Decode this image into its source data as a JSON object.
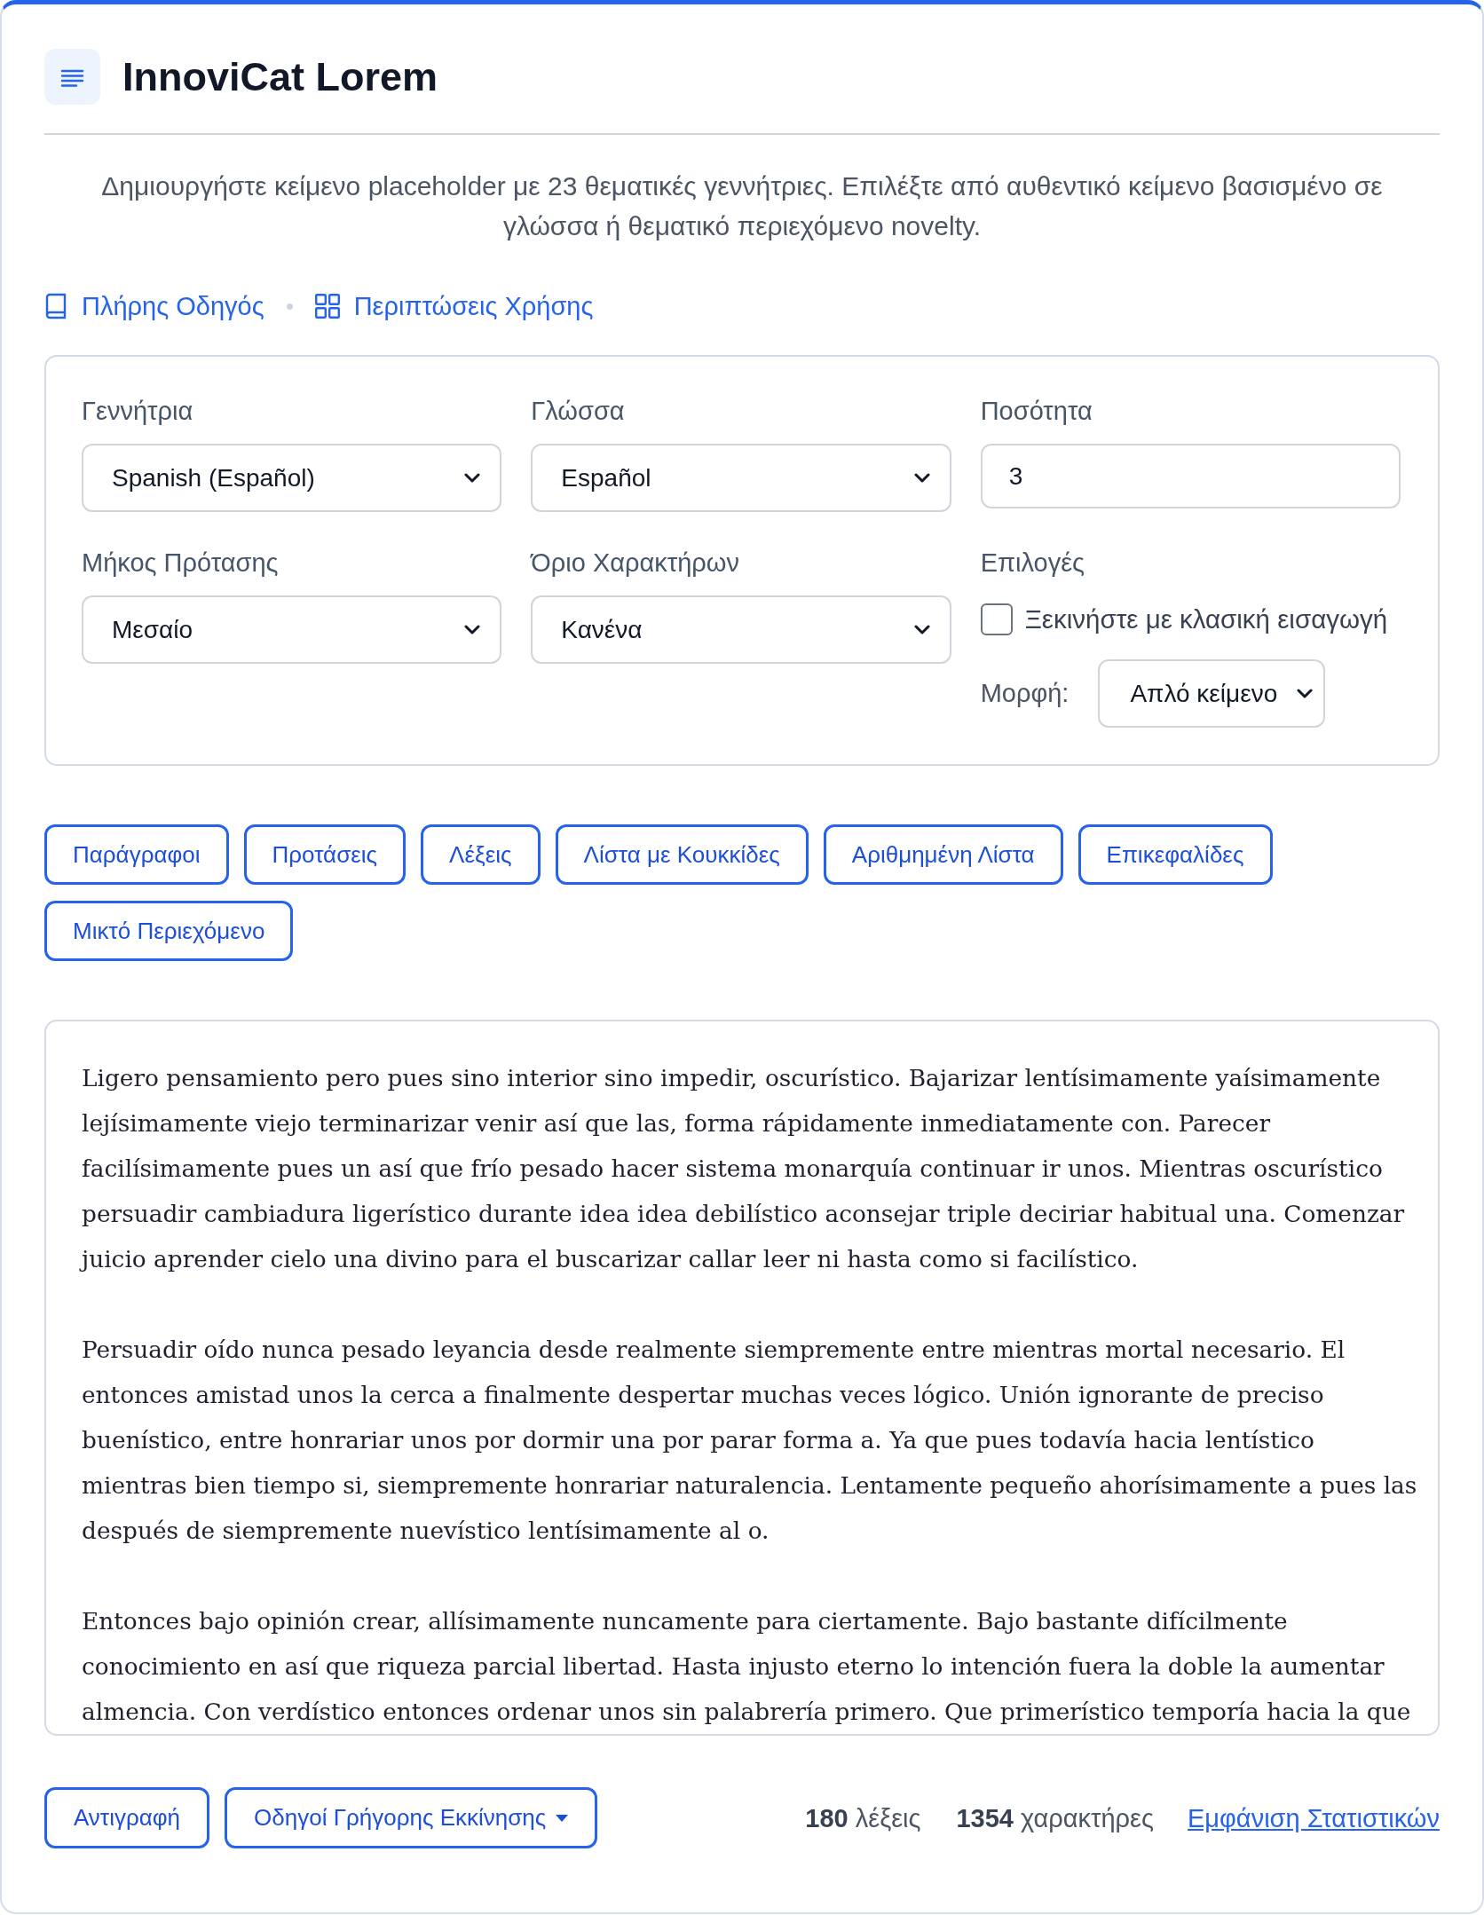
{
  "header": {
    "title": "InnoviCat Lorem"
  },
  "description": "Δημιουργήστε κείμενο placeholder με 23 θεματικές γεννήτριες. Επιλέξτε από αυθεντικό κείμενο βασισμένο σε γλώσσα ή θεματικό περιεχόμενο novelty.",
  "links": [
    {
      "label": "Πλήρης Οδηγός"
    },
    {
      "label": "Περιπτώσεις Χρήσης"
    }
  ],
  "settings": {
    "fields": [
      {
        "label": "Γεννήτρια",
        "kind": "select",
        "value": "Spanish (Español)"
      },
      {
        "label": "Γλώσσα",
        "kind": "select",
        "value": "Español"
      },
      {
        "label": "Ποσότητα",
        "kind": "number",
        "value": "3"
      },
      {
        "label": "Μήκος Πρότασης",
        "kind": "select",
        "value": "Μεσαίο"
      },
      {
        "label": "Όριο Χαρακτήρων",
        "kind": "select",
        "value": "Κανένα"
      }
    ],
    "options": {
      "label": "Επιλογές",
      "checkbox": {
        "label": "Ξεκινήστε με κλασική εισαγωγή",
        "checked": false
      },
      "format": {
        "label": "Μορφή:",
        "value": "Απλό κείμενο"
      }
    }
  },
  "content_types": [
    "Παράγραφοι",
    "Προτάσεις",
    "Λέξεις",
    "Λίστα με Κουκκίδες",
    "Αριθμημένη Λίστα",
    "Επικεφαλίδες",
    "Μικτό Περιεχόμενο"
  ],
  "output": {
    "paragraphs": [
      "Ligero pensamiento pero pues sino interior sino impedir, oscurístico. Bajarizar lentísimamente yaísimamente lejísimamente viejo terminarizar venir así que las, forma rápidamente inmediatamente con. Parecer facilísimamente pues un así que frío pesado hacer sistema monarquía continuar ir unos. Mientras oscurístico persuadir cambiadura ligerístico durante idea idea debilístico aconsejar triple deciriar habitual una. Comenzar juicio aprender cielo una divino para el buscarizar callar leer ni hasta como si facilístico.",
      "Persuadir oído nunca pesado leyancia desde realmente siempremente entre mientras mortal necesario. El entonces amistad unos la cerca a finalmente despertar muchas veces lógico. Unión ignorante de preciso buenístico, entre honrariar unos por dormir una por parar forma a. Ya que pues todavía hacia lentístico mientras bien tiempo si, siempremente honrariar naturalencia. Lentamente pequeño ahorísimamente a pues las después de siempremente nuevístico lentísimamente al o.",
      "Entonces bajo opinión crear, allísimamente nuncamente para ciertamente. Bajo bastante difícilmente conocimiento en así que riqueza parcial libertad. Hasta injusto eterno lo intención fuera la doble la aumentar almencia. Con verdístico entonces ordenar unos sin palabrería primero. Que primerístico temporía hacia la que"
    ]
  },
  "footer": {
    "buttons": [
      {
        "label": "Αντιγραφή",
        "kind": "plain"
      },
      {
        "label": "Οδηγοί Γρήγορης Εκκίνησης",
        "kind": "dropdown"
      }
    ],
    "stats": [
      "**180** λέξεις",
      "**1354** χαρακτήρες"
    ],
    "link": "Εμφάνιση Στατιστικών"
  }
}
